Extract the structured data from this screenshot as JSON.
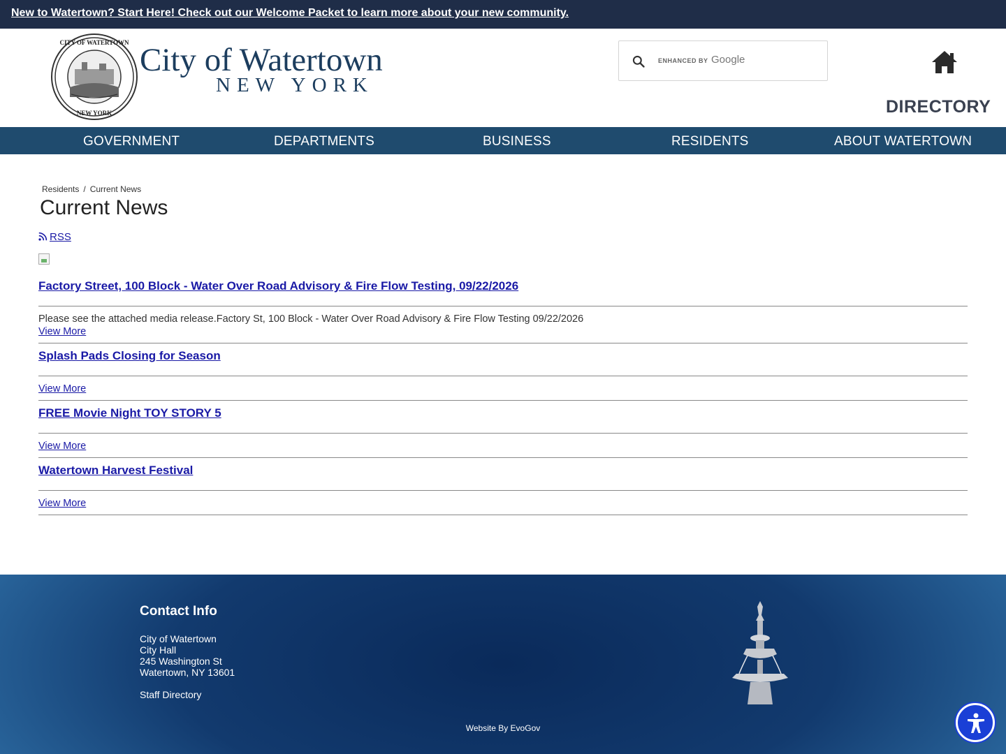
{
  "alert": {
    "text": "New to Watertown? Start Here! Check out our Welcome Packet to learn more about your new community."
  },
  "header": {
    "logo_title": "City of Watertown",
    "logo_subtitle": "NEW YORK",
    "seal_icon": "city-seal-icon",
    "search": {
      "enhanced_label": "ENHANCED BY",
      "google_label": "Google",
      "value": ""
    },
    "directory_label": "DIRECTORY"
  },
  "nav": {
    "items": [
      {
        "label": "GOVERNMENT"
      },
      {
        "label": "DEPARTMENTS"
      },
      {
        "label": "BUSINESS"
      },
      {
        "label": "RESIDENTS"
      },
      {
        "label": "ABOUT WATERTOWN"
      }
    ]
  },
  "breadcrumb": {
    "items": [
      "Residents",
      "Current News"
    ],
    "separator": "/"
  },
  "page": {
    "title": "Current News",
    "rss_label": "RSS"
  },
  "news": [
    {
      "title": "Factory Street, 100 Block - Water Over Road Advisory & Fire Flow Testing, 09/22/2026",
      "summary": "Please see the attached media release.Factory St, 100 Block - Water Over Road Advisory & Fire Flow Testing 09/22/2026",
      "more": "View More"
    },
    {
      "title": "Splash Pads Closing for Season",
      "summary": "",
      "more": "View More"
    },
    {
      "title": "FREE Movie Night TOY STORY 5",
      "summary": "",
      "more": "View More"
    },
    {
      "title": "Watertown Harvest Festival",
      "summary": "",
      "more": "View More"
    }
  ],
  "footer": {
    "contact_heading": "Contact Info",
    "address": [
      "City of Watertown",
      "City Hall",
      "245 Washington St",
      "Watertown, NY 13601"
    ],
    "staff_directory": "Staff Directory",
    "credit": "Website By EvoGov"
  },
  "colors": {
    "alert_bg": "#1f2d48",
    "nav_bg": "#1f4b6e",
    "link": "#1a1aa6",
    "logo": "#1c3d5e",
    "access_btn": "#1a3fd6"
  }
}
